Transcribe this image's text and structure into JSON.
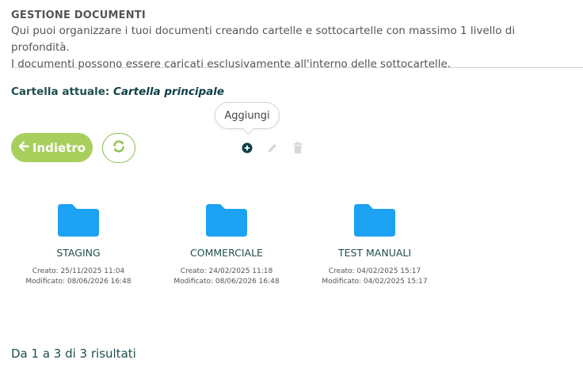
{
  "header": {
    "title": "GESTIONE DOCUMENTI",
    "line1": "Qui puoi organizzare i tuoi documenti creando cartelle e sottocartelle con massimo 1 livello di profondità.",
    "line2": "I documenti possono essere caricati esclusivamente all'interno delle sottocartelle."
  },
  "current_folder": {
    "label": "Cartella attuale:",
    "value": "Cartella principale"
  },
  "toolbar": {
    "back_label": "Indietro",
    "tooltip": "Aggiungi",
    "icons": [
      "arrow-left-icon",
      "refresh-icon",
      "add-circle-icon",
      "pencil-icon",
      "trash-icon"
    ]
  },
  "folders": [
    {
      "name": "STAGING",
      "created": "Creato: 25/11/2025 11:04",
      "modified": "Modificato: 08/06/2026 16:48"
    },
    {
      "name": "COMMERCIALE",
      "created": "Creato: 24/02/2025 11:18",
      "modified": "Modificato: 08/06/2026 16:48"
    },
    {
      "name": "TEST MANUALI",
      "created": "Creato: 04/02/2025 15:17",
      "modified": "Modificato: 04/02/2025 15:17"
    }
  ],
  "pagination": {
    "summary": "Da 1 a 3 di 3 risultati"
  },
  "colors": {
    "accent_green": "#a8cf5c",
    "folder_blue": "#1da1f2",
    "dark_teal": "#0b3f47"
  }
}
